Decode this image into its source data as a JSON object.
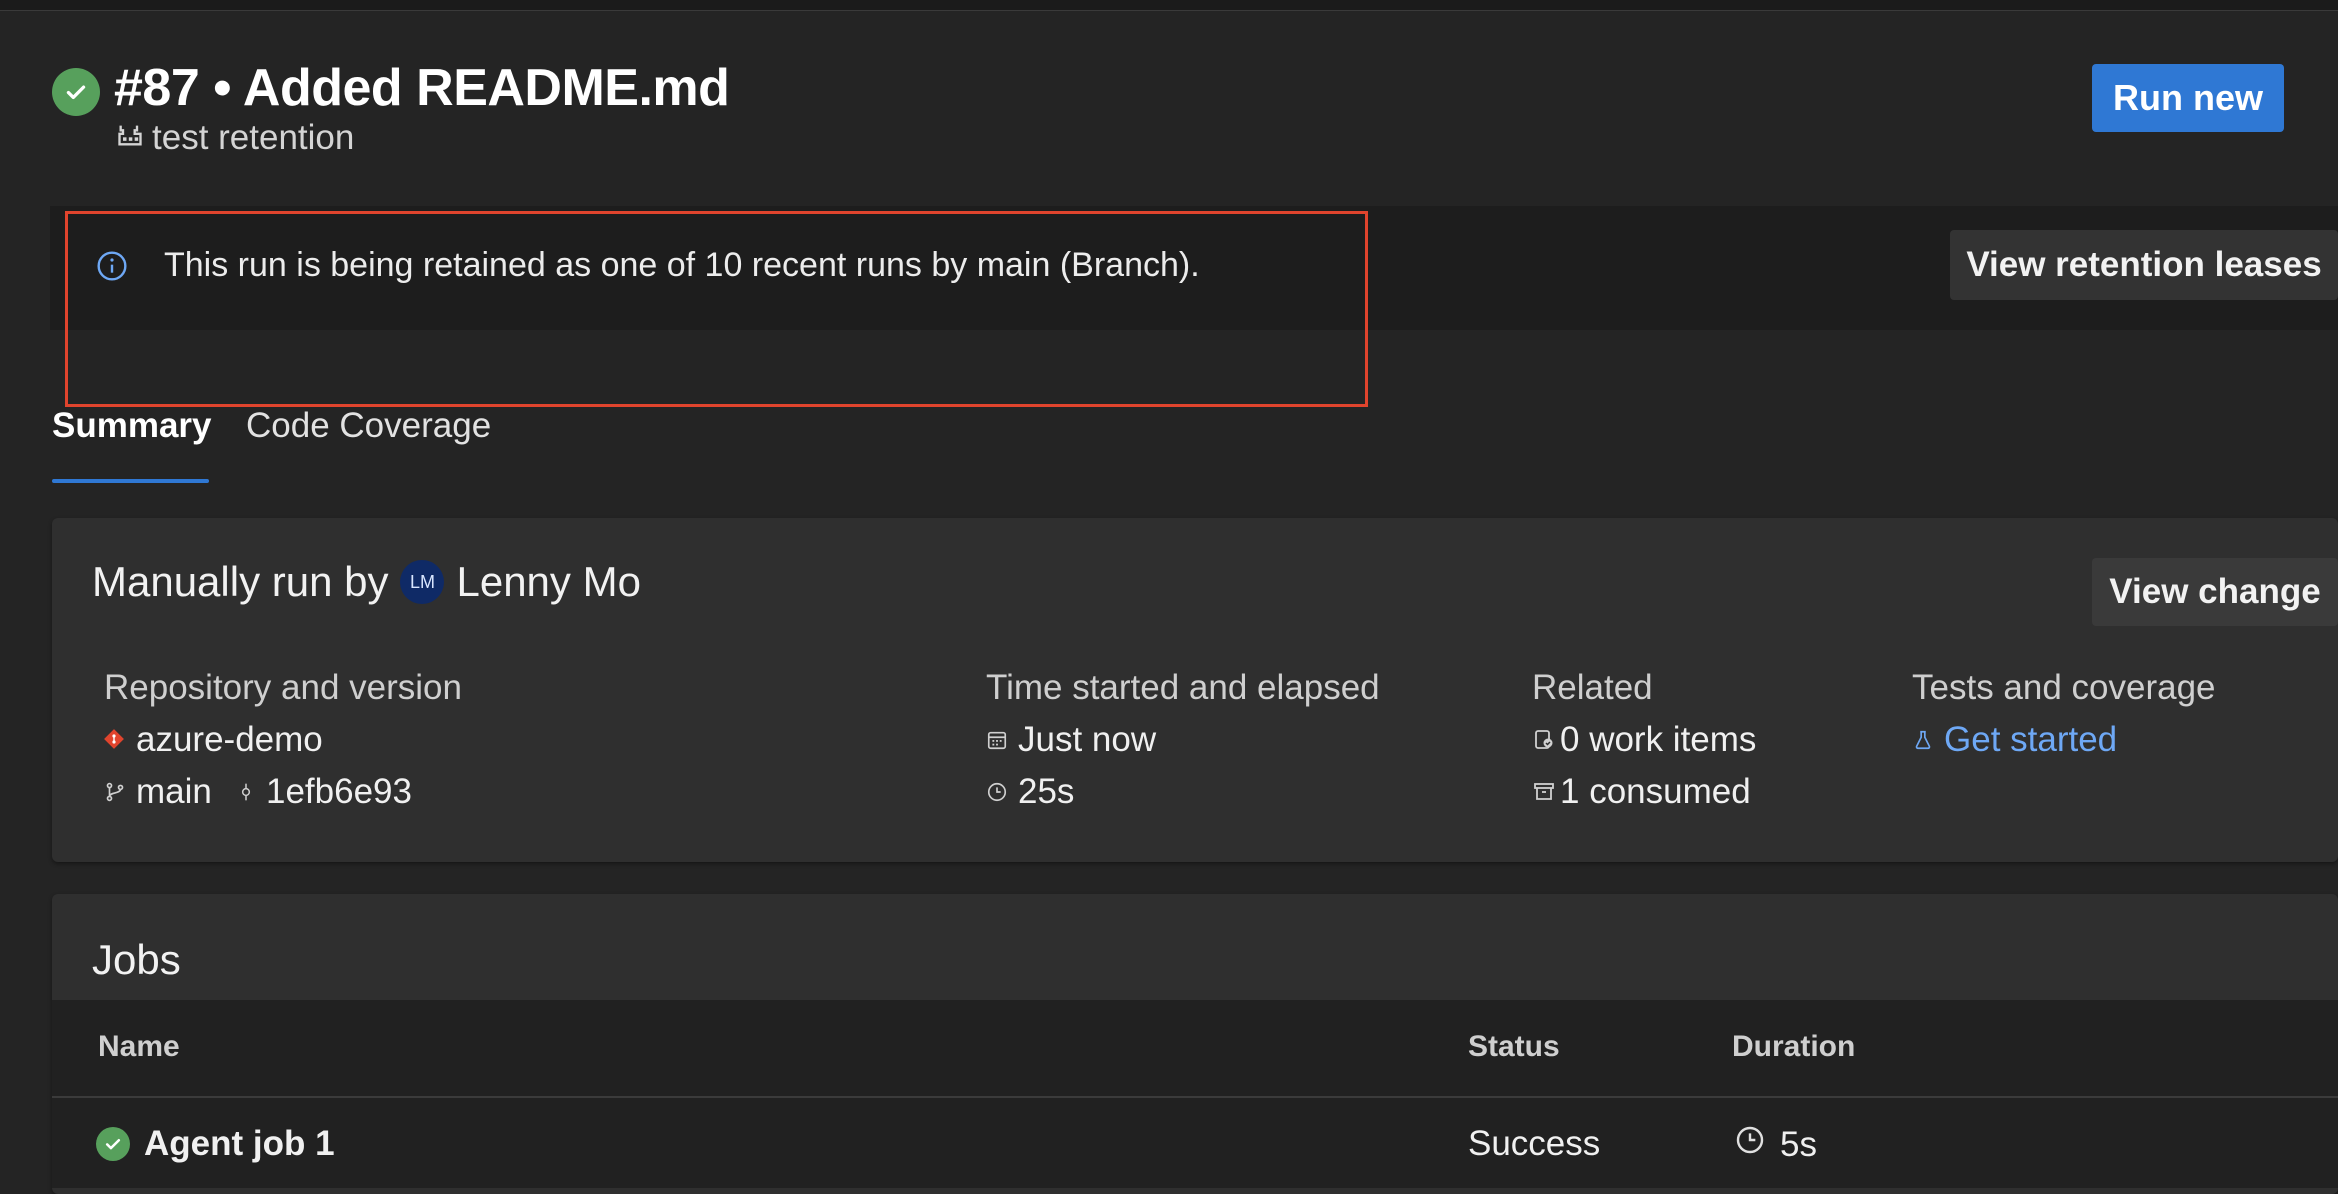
{
  "run": {
    "number_title": "#87 • Added README.md",
    "pipeline_name": "test retention",
    "run_new_label": "Run new"
  },
  "banner": {
    "message": "This run is being retained as one of 10 recent runs by main (Branch).",
    "button_label": "View retention leases"
  },
  "tabs": [
    {
      "label": "Summary",
      "active": true
    },
    {
      "label": "Code Coverage",
      "active": false
    }
  ],
  "summary": {
    "title_prefix": "Manually run by",
    "user_initials": "LM",
    "user_name": "Lenny Mo",
    "view_change_label": "View change",
    "repository": {
      "heading": "Repository and version",
      "repo": "azure-demo",
      "branch": "main",
      "commit": "1efb6e93"
    },
    "time": {
      "heading": "Time started and elapsed",
      "started": "Just now",
      "elapsed": "25s"
    },
    "related": {
      "heading": "Related",
      "work_items": "0 work items",
      "consumed": "1 consumed"
    },
    "tests": {
      "heading": "Tests and coverage",
      "link": "Get started"
    }
  },
  "jobs": {
    "title": "Jobs",
    "columns": [
      "Name",
      "Status",
      "Duration"
    ],
    "rows": [
      {
        "name": "Agent job 1",
        "status": "Success",
        "duration": "5s"
      }
    ]
  },
  "colors": {
    "background": "#242424",
    "success": "#57a05c",
    "accent": "#2f78d4",
    "highlight": "#e0442d",
    "link": "#6ea8f5"
  }
}
